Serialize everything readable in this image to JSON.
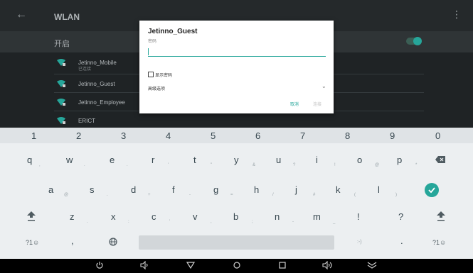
{
  "header": {
    "title": "WLAN",
    "back_icon": "back-arrow-icon",
    "more_icon": "more-vert-icon"
  },
  "wlan_switch": {
    "label": "开启",
    "state": "on"
  },
  "networks": [
    {
      "name": "Jetinno_Mobile",
      "status": "已连接"
    },
    {
      "name": "Jetinno_Guest",
      "status": ""
    },
    {
      "name": "Jetinno_Employee",
      "status": ""
    },
    {
      "name": "ERICT",
      "status": ""
    }
  ],
  "dialog": {
    "title": "Jetinno_Guest",
    "password_label": "密码",
    "password_value": "",
    "show_password_label": "显示密码",
    "advanced_label": "高级选项",
    "cancel_label": "取消",
    "connect_label": "连接"
  },
  "keyboard": {
    "numbers": [
      "1",
      "2",
      "3",
      "4",
      "5",
      "6",
      "7",
      "8",
      "9",
      "0"
    ],
    "row1": [
      {
        "key": "q",
        "hint": ","
      },
      {
        "key": "w",
        "hint": "."
      },
      {
        "key": "e",
        "hint": "."
      },
      {
        "key": "r",
        "hint": "'"
      },
      {
        "key": "t",
        "hint": "\""
      },
      {
        "key": "y",
        "hint": "&"
      },
      {
        "key": "u",
        "hint": "?"
      },
      {
        "key": "i",
        "hint": "!"
      },
      {
        "key": "o",
        "hint": "@"
      },
      {
        "key": "p",
        "hint": "*"
      }
    ],
    "row2": [
      {
        "key": "a",
        "hint": "@"
      },
      {
        "key": "s",
        "hint": "."
      },
      {
        "key": "d",
        "hint": "+"
      },
      {
        "key": "f",
        "hint": "-"
      },
      {
        "key": "g",
        "hint": "="
      },
      {
        "key": "h",
        "hint": "/"
      },
      {
        "key": "j",
        "hint": "#"
      },
      {
        "key": "k",
        "hint": "("
      },
      {
        "key": "l",
        "hint": ")"
      }
    ],
    "row3": [
      {
        "key": "z",
        "hint": "."
      },
      {
        "key": "x",
        "hint": ":"
      },
      {
        "key": "c",
        "hint": "'"
      },
      {
        "key": "v",
        "hint": ","
      },
      {
        "key": "b",
        "hint": ";"
      },
      {
        "key": "n",
        "hint": "-"
      },
      {
        "key": "m",
        "hint": "_"
      },
      {
        "key": "!",
        "hint": ""
      },
      {
        "key": "?",
        "hint": ""
      }
    ],
    "bottom": {
      "sym_left": "?1☺",
      "comma": ",",
      "emoji": ":-)",
      "period": ".",
      "sym_right": "?1☺"
    }
  },
  "colors": {
    "accent": "#26a69a",
    "status_bg": "#1f2325",
    "keyboard_bg": "#eceff1"
  }
}
